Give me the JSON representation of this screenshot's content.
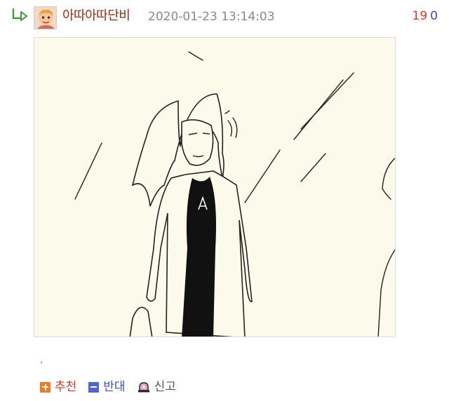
{
  "comment": {
    "author": "아따아따단비",
    "timestamp": "2020-01-23 13:14:03",
    "votes": {
      "up": "19",
      "down": "0"
    },
    "body_text": "."
  },
  "actions": {
    "recommend_label": "추천",
    "oppose_label": "반대",
    "report_label": "신고"
  },
  "icons": {
    "reply": "reply-arrow-icon",
    "recommend": "plus-icon",
    "oppose": "minus-icon",
    "report": "siren-icon"
  },
  "colors": {
    "author": "#a32a0f",
    "timestamp": "#8a8a8a",
    "vote_up": "#e0362a",
    "vote_down": "#2d4fd1",
    "recommend_icon": "#ee7d20",
    "oppose_icon": "#4f66c9",
    "reply_arrow": "#3a9a3a",
    "image_background": "#fcfaea"
  }
}
